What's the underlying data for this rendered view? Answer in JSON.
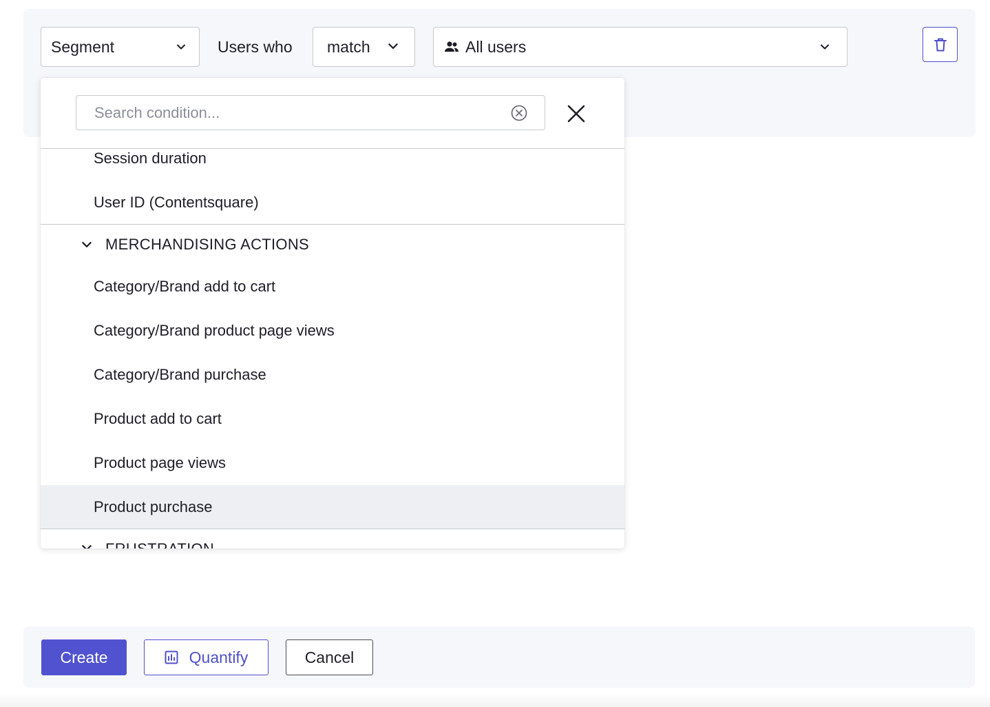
{
  "condition": {
    "segment_select": "Segment",
    "users_who_label": "Users who",
    "match_select": "match",
    "users_select": "All users"
  },
  "dropdown": {
    "search_placeholder": "Search condition...",
    "items_above": [
      "Session duration",
      "User ID (Contentsquare)"
    ],
    "group_merchandising": {
      "label": "MERCHANDISING ACTIONS",
      "items": [
        "Category/Brand add to cart",
        "Category/Brand product page views",
        "Category/Brand purchase",
        "Product add to cart",
        "Product page views",
        "Product purchase"
      ],
      "selected_item": "Product purchase"
    },
    "group_frustration": {
      "label": "FRUSTRATION"
    }
  },
  "footer": {
    "create_label": "Create",
    "quantify_label": "Quantify",
    "cancel_label": "Cancel"
  },
  "colors": {
    "accent": "#5052d0",
    "panel_bg": "#f6f7fb",
    "selected_row_bg": "#eeeff2",
    "border": "#c8c9d0"
  },
  "icons": [
    "chevron-down-icon",
    "users-icon",
    "trash-icon",
    "clear-circle-icon",
    "close-icon",
    "bar-chart-icon"
  ]
}
